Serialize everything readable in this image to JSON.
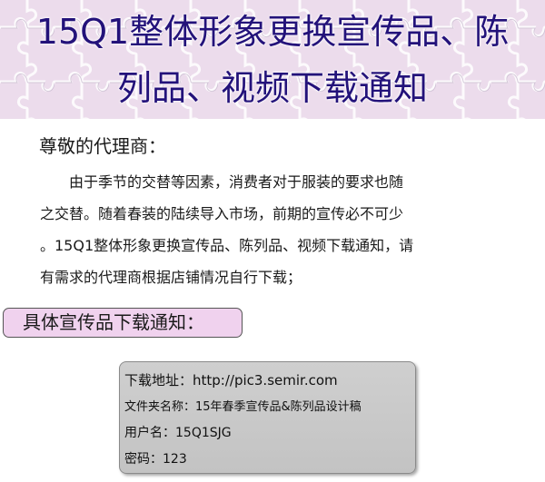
{
  "banner": {
    "title_line1": "15Q1整体形象更换宣传品、陈",
    "title_line2": "列品、视频下载通知",
    "background_color": "#ecdcec",
    "title_color": "#23127a"
  },
  "greeting": "尊敬的代理商：",
  "body": {
    "lines": [
      "由于季节的交替等因素，消费者对于服装的要求也随",
      "之交替。随着春装的陆续导入市场，前期的宣传必不可少",
      "。15Q1整体形象更换宣传品、陈列品、视频下载通知，请",
      "有需求的代理商根据店铺情况自行下载；"
    ]
  },
  "section": {
    "label": "具体宣传品下载通知：",
    "background_color": "#f0d2ee"
  },
  "info": {
    "download_address": "下载地址：http://pic3.semir.com",
    "folder_name": "文件夹名称：15年春季宣传品&陈列品设计稿",
    "username": "用户名：15Q1SJG",
    "password": "密码：123"
  }
}
